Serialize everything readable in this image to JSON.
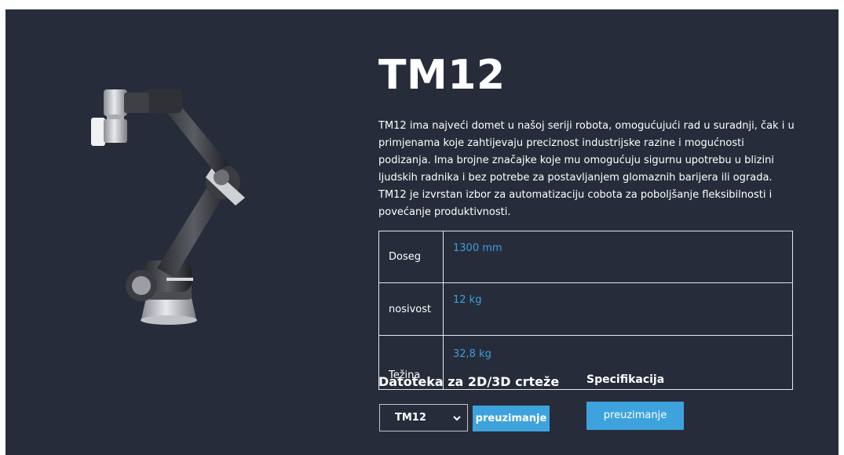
{
  "product": {
    "title": "TM12",
    "description": "TM12 ima najveći domet u našoj seriji robota, omogućujući rad u suradnji, čak i u primjenama koje zahtijevaju preciznost industrijske razine i mogućnosti podizanja. Ima brojne značajke koje mu omogućuju sigurnu upotrebu u blizini ljudskih radnika i bez potrebe za postavljanjem glomaznih barijera ili ograda. TM12 je izvrstan izbor za automatizaciju cobota za poboljšanje fleksibilnosti i povećanje produktivnosti."
  },
  "specs": [
    {
      "label": "Doseg",
      "value": "1300 mm"
    },
    {
      "label": "nosivost",
      "value": "12 kg"
    },
    {
      "label": "Težina",
      "value": "32,8 kg"
    }
  ],
  "downloads": {
    "files_heading": "Datoteka za 2D/3D crteže",
    "model_select": {
      "selected": "TM12"
    },
    "files_button": "preuzimanje",
    "spec_heading": "Specifikacija",
    "spec_button": "preuzimanje"
  },
  "colors": {
    "background": "#272c3a",
    "accent": "#3ea3dd",
    "value_text": "#3d9fdc"
  }
}
